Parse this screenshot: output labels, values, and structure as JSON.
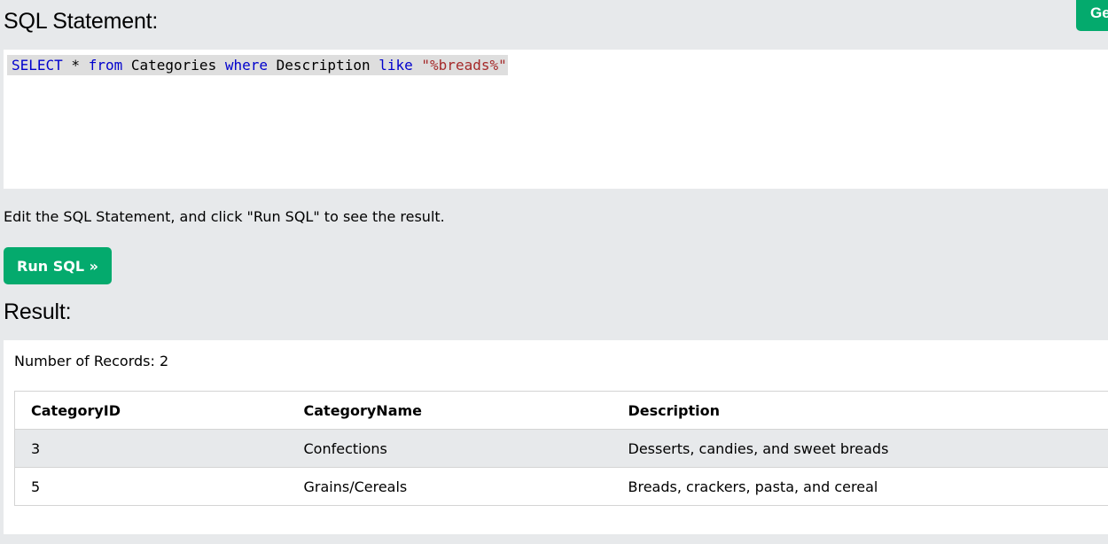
{
  "header_button": {
    "label": "Get your own SQL server",
    "visible_label": "Ge"
  },
  "editor": {
    "heading": "SQL Statement:",
    "tokens": [
      {
        "text": "SELECT",
        "type": "keyword"
      },
      {
        "text": " * ",
        "type": "plain"
      },
      {
        "text": "from",
        "type": "keyword"
      },
      {
        "text": " Categories ",
        "type": "plain"
      },
      {
        "text": "where",
        "type": "keyword"
      },
      {
        "text": " Description ",
        "type": "plain"
      },
      {
        "text": "like",
        "type": "keyword"
      },
      {
        "text": " ",
        "type": "plain"
      },
      {
        "text": "\"%breads%\"",
        "type": "string"
      }
    ]
  },
  "instructions": "Edit the SQL Statement, and click \"Run SQL\" to see the result.",
  "run_button": {
    "label": "Run SQL »"
  },
  "result": {
    "heading": "Result:",
    "record_count": "Number of Records: 2",
    "columns": [
      "CategoryID",
      "CategoryName",
      "Description"
    ],
    "rows": [
      [
        "3",
        "Confections",
        "Desserts, candies, and sweet breads"
      ],
      [
        "5",
        "Grains/Cereals",
        "Breads, crackers, pasta, and cereal"
      ]
    ]
  },
  "colors": {
    "accent": "#04aa6d",
    "background": "#e7e9eb",
    "keyword": "#0000cd",
    "string": "#a52a2a"
  }
}
